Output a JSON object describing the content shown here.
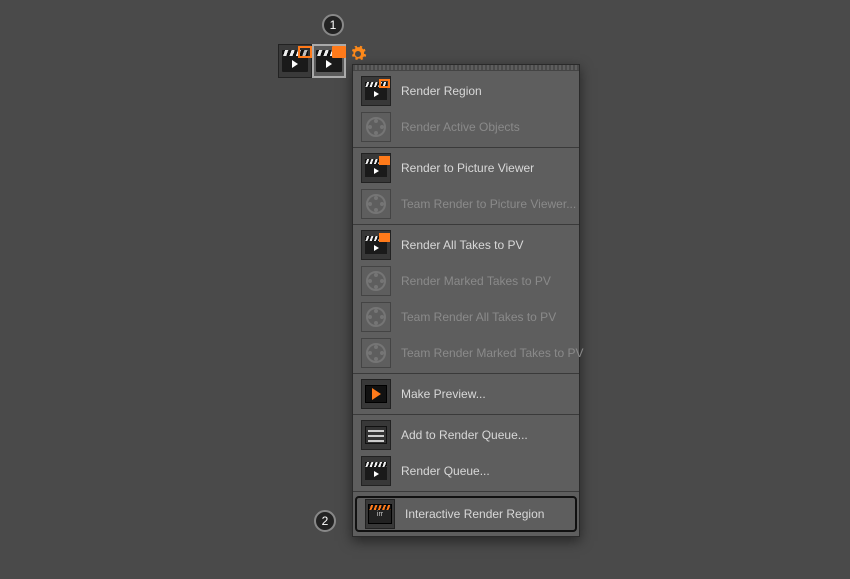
{
  "annotations": {
    "badge1": "1",
    "badge2": "2"
  },
  "toolbar": {
    "render_region_btn": "Render Region",
    "render_pv_btn": "Render to Picture Viewer",
    "settings_btn": "Render Settings"
  },
  "menu": {
    "items": [
      {
        "label": "Render Region",
        "enabled": true,
        "icon": "clap-region"
      },
      {
        "label": "Render Active Objects",
        "enabled": false,
        "icon": "reel"
      },
      {
        "label": "Render to Picture Viewer",
        "enabled": true,
        "icon": "clap-image"
      },
      {
        "label": "Team Render to Picture Viewer...",
        "enabled": false,
        "icon": "reel"
      },
      {
        "label": "Render All Takes to PV",
        "enabled": true,
        "icon": "clap-image"
      },
      {
        "label": "Render Marked Takes to PV",
        "enabled": false,
        "icon": "reel"
      },
      {
        "label": "Team Render All Takes to PV",
        "enabled": false,
        "icon": "reel"
      },
      {
        "label": "Team Render Marked Takes to PV",
        "enabled": false,
        "icon": "reel"
      },
      {
        "label": "Make Preview...",
        "enabled": true,
        "icon": "preview"
      },
      {
        "label": "Add to Render Queue...",
        "enabled": true,
        "icon": "queue-add"
      },
      {
        "label": "Render Queue...",
        "enabled": true,
        "icon": "clap-plain"
      },
      {
        "label": "Interactive Render Region",
        "enabled": true,
        "icon": "irr",
        "highlight": true
      }
    ]
  }
}
